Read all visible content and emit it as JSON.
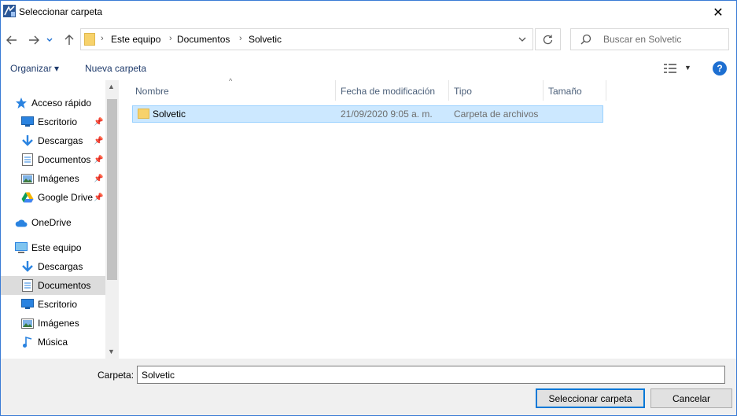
{
  "window": {
    "title": "Seleccionar carpeta",
    "close_glyph": "✕"
  },
  "address": {
    "breadcrumbs": [
      "Este equipo",
      "Documentos",
      "Solvetic"
    ],
    "search_placeholder": "Buscar en Solvetic"
  },
  "toolbar": {
    "organize": "Organizar ▾",
    "new_folder": "Nueva carpeta",
    "help": "?"
  },
  "nav": {
    "items": [
      {
        "label": "Acceso rápido",
        "icon": "star-icon",
        "pinned": false
      },
      {
        "label": "Escritorio",
        "icon": "desktop-icon",
        "pinned": true
      },
      {
        "label": "Descargas",
        "icon": "download-icon",
        "pinned": true
      },
      {
        "label": "Documentos",
        "icon": "document-icon",
        "pinned": true
      },
      {
        "label": "Imágenes",
        "icon": "pictures-icon",
        "pinned": true
      },
      {
        "label": "Google Drive",
        "icon": "google-drive-icon",
        "pinned": true
      },
      {
        "label": "OneDrive",
        "icon": "onedrive-icon",
        "pinned": false
      },
      {
        "label": "Este equipo",
        "icon": "computer-icon",
        "pinned": false
      },
      {
        "label": "Descargas",
        "icon": "download-icon",
        "pinned": false
      },
      {
        "label": "Documentos",
        "icon": "document-icon",
        "pinned": false,
        "selected": true
      },
      {
        "label": "Escritorio",
        "icon": "desktop-icon",
        "pinned": false
      },
      {
        "label": "Imágenes",
        "icon": "pictures-icon",
        "pinned": false
      },
      {
        "label": "Música",
        "icon": "music-icon",
        "pinned": false
      }
    ]
  },
  "list": {
    "columns": [
      "Nombre",
      "Fecha de modificación",
      "Tipo",
      "Tamaño"
    ],
    "rows": [
      {
        "name": "Solvetic",
        "date": "21/09/2020 9:05 a. m.",
        "type": "Carpeta de archivos",
        "size": ""
      }
    ]
  },
  "footer": {
    "folder_label": "Carpeta:",
    "folder_value": "Solvetic",
    "select_button": "Seleccionar carpeta",
    "cancel_button": "Cancelar"
  },
  "colors": {
    "accent": "#0078d7",
    "selection": "#cce8ff",
    "folder": "#f7d26b"
  }
}
